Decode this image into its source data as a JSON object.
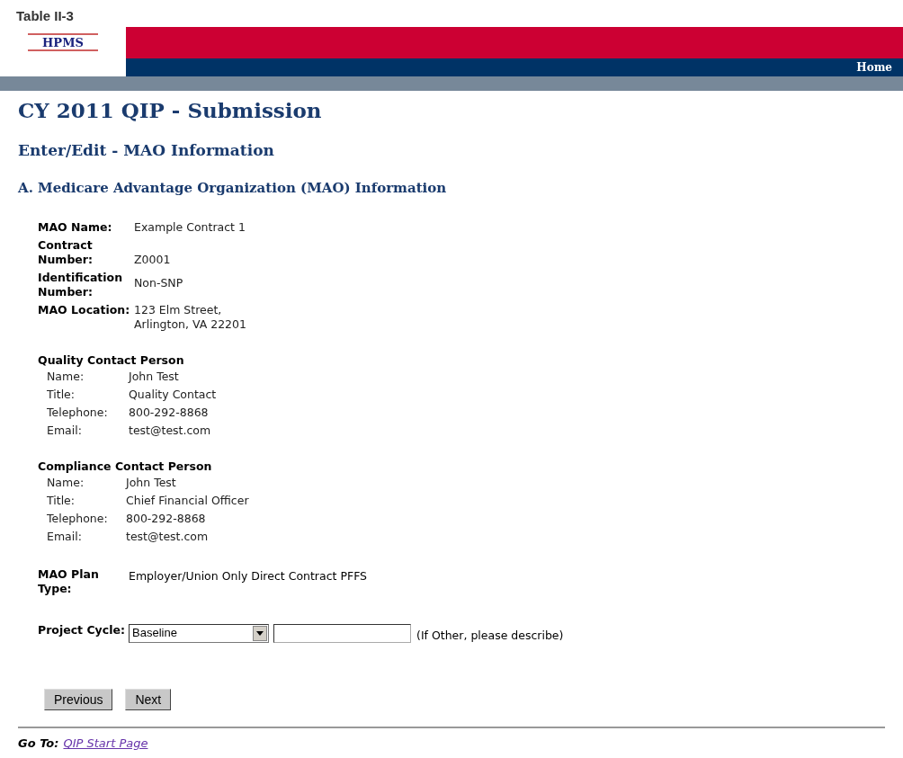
{
  "caption": "Table II-3",
  "header": {
    "logo": "HPMS",
    "nav": [
      "Home"
    ]
  },
  "page_title": "CY 2011 QIP - Submission",
  "subtitle": "Enter/Edit - MAO Information",
  "section_title": "A. Medicare Advantage Organization (MAO) Information",
  "mao_fields": [
    {
      "label": "MAO Name:",
      "value": [
        "Example Contract 1"
      ]
    },
    {
      "label": "Contract Number:",
      "value": [
        "Z0001"
      ]
    },
    {
      "label": "Identification Number:",
      "value": [
        "Non-SNP"
      ]
    },
    {
      "label": "MAO Location:",
      "value": [
        "123 Elm Street,",
        "Arlington, VA 22201"
      ]
    }
  ],
  "contacts": [
    {
      "heading": "Quality Contact Person",
      "fields": [
        {
          "label": "Name:",
          "value": "John Test"
        },
        {
          "label": "Title:",
          "value": "Quality Contact"
        },
        {
          "label": "Telephone:",
          "value": "800-292-8868"
        },
        {
          "label": "Email:",
          "value": "test@test.com"
        }
      ]
    },
    {
      "heading": "Compliance Contact Person",
      "fields": [
        {
          "label": "Name:",
          "value": "John Test"
        },
        {
          "label": "Title:",
          "value": "Chief Financial Officer"
        },
        {
          "label": "Telephone:",
          "value": "800-292-8868"
        },
        {
          "label": "Email:",
          "value": "test@test.com"
        }
      ]
    }
  ],
  "plan_type": {
    "label": "MAO Plan Type:",
    "value": "Employer/Union Only Direct Contract PFFS"
  },
  "project_cycle": {
    "label": "Project Cycle:",
    "select_value": "Baseline",
    "hint": "(If Other, please describe)"
  },
  "buttons": [
    "Previous",
    "Next"
  ],
  "footer": {
    "label": "Go To:",
    "link": "QIP Start Page"
  }
}
